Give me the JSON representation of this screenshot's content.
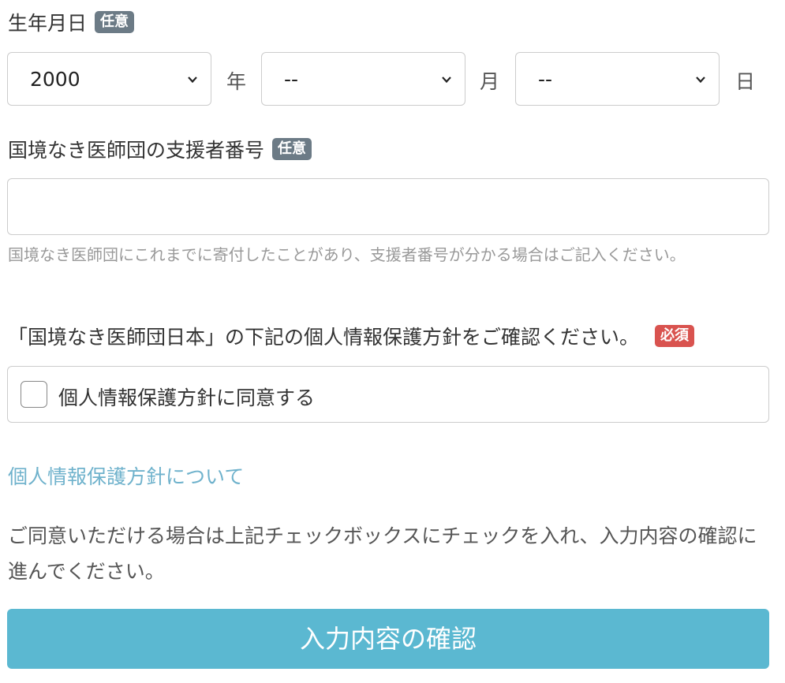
{
  "birthdate": {
    "label": "生年月日",
    "badge": "任意",
    "year": {
      "value": "2000",
      "unit": "年"
    },
    "month": {
      "value": "--",
      "unit": "月"
    },
    "day": {
      "value": "--",
      "unit": "日"
    }
  },
  "supporter": {
    "label": "国境なき医師団の支援者番号",
    "badge": "任意",
    "value": "",
    "help": "国境なき医師団にこれまでに寄付したことがあり、支援者番号が分かる場合はご記入ください。"
  },
  "privacy": {
    "label": "「国境なき医師団日本」の下記の個人情報保護方針をご確認ください。",
    "badge": "必須",
    "checkbox_label": "個人情報保護方針に同意する",
    "link": "個人情報保護方針について",
    "note": "ご同意いただける場合は上記チェックボックスにチェックを入れ、入力内容の確認に進んでください。"
  },
  "submit_label": "入力内容の確認",
  "colors": {
    "optional_badge": "#6c7b86",
    "required_badge": "#d9534f",
    "link": "#6fb2cc",
    "button": "#5bb8d1"
  }
}
